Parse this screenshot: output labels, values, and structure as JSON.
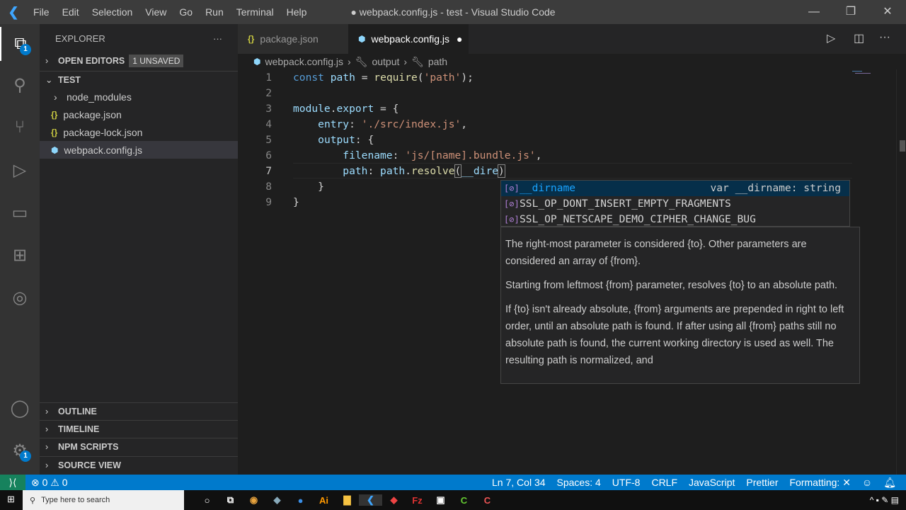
{
  "window": {
    "title": "● webpack.config.js - test - Visual Studio Code",
    "minimize": "—",
    "restore": "❐",
    "close": "✕"
  },
  "menu": [
    "File",
    "Edit",
    "Selection",
    "View",
    "Go",
    "Run",
    "Terminal",
    "Help"
  ],
  "activity": {
    "explorer_badge": "1",
    "settings_badge": "1"
  },
  "sidebar": {
    "title": "EXPLORER",
    "more": "···",
    "open_editors": "OPEN EDITORS",
    "unsaved": "1 UNSAVED",
    "folder": "TEST",
    "files": [
      {
        "name": "node_modules",
        "type": "folder"
      },
      {
        "name": "package.json",
        "type": "json"
      },
      {
        "name": "package-lock.json",
        "type": "json"
      },
      {
        "name": "webpack.config.js",
        "type": "webpack",
        "selected": true
      }
    ],
    "sections": [
      "OUTLINE",
      "TIMELINE",
      "NPM SCRIPTS",
      "SOURCE VIEW"
    ]
  },
  "tabs": [
    {
      "label": "package.json",
      "icon": "{}"
    },
    {
      "label": "webpack.config.js",
      "modified": "●"
    }
  ],
  "breadcrumb": [
    "webpack.config.js",
    "output",
    "path"
  ],
  "editor": {
    "line_numbers": [
      "1",
      "2",
      "3",
      "4",
      "5",
      "6",
      "7",
      "8",
      "9"
    ]
  },
  "suggest": {
    "items": [
      {
        "label": "__dirname",
        "detail": "var __dirname: string"
      },
      {
        "label": "SSL_OP_DONT_INSERT_EMPTY_FRAGMENTS"
      },
      {
        "label": "SSL_OP_NETSCAPE_DEMO_CIPHER_CHANGE_BUG"
      }
    ],
    "doc": [
      "The right-most parameter is considered {to}. Other parameters are considered an array of {from}.",
      "Starting from leftmost {from} parameter, resolves {to} to an absolute path.",
      "If {to} isn't already absolute, {from} arguments are prepended in right to left order, until an absolute path is found. If after using all {from} paths still no absolute path is found, the current working directory is used as well. The resulting path is normalized, and"
    ]
  },
  "status": {
    "errors": "0",
    "warnings": "0",
    "position": "Ln 7, Col 34",
    "spaces": "Spaces: 4",
    "encoding": "UTF-8",
    "eol": "CRLF",
    "language": "JavaScript",
    "prettier": "Prettier",
    "formatting": "Formatting: ✕"
  },
  "taskbar": {
    "search_placeholder": "Type here to search"
  }
}
